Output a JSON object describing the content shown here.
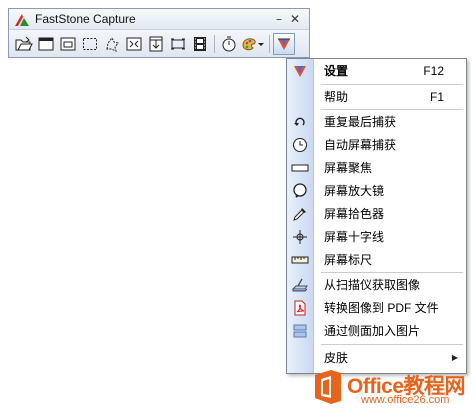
{
  "window": {
    "title": "FastStone Capture",
    "minimize_glyph": "–",
    "close_glyph": "✕"
  },
  "toolbar": {
    "icons": [
      "open-folder-icon",
      "capture-window-icon",
      "capture-object-icon",
      "capture-rectangle-icon",
      "capture-freehand-icon",
      "capture-fullscreen-icon",
      "capture-scrolling-icon",
      "capture-fixed-region-icon",
      "screen-recorder-icon",
      "delay-timer-icon",
      "output-destination-icon",
      "main-menu-icon"
    ]
  },
  "menu": {
    "items": [
      {
        "label": "设置",
        "shortcut": "F12",
        "icon": "settings-icon"
      },
      {
        "label": "帮助",
        "shortcut": "F1"
      },
      {
        "label": "重复最后捕获",
        "icon": "repeat-capture-icon"
      },
      {
        "label": "自动屏幕捕获",
        "icon": "clock-icon"
      },
      {
        "label": "屏幕聚焦",
        "icon": "spotlight-icon"
      },
      {
        "label": "屏幕放大镜",
        "icon": "magnifier-icon"
      },
      {
        "label": "屏幕拾色器",
        "icon": "eyedropper-icon"
      },
      {
        "label": "屏幕十字线",
        "icon": "crosshair-icon"
      },
      {
        "label": "屏幕标尺",
        "icon": "ruler-icon"
      },
      {
        "label": "从扫描仪获取图像",
        "icon": "scanner-icon"
      },
      {
        "label": "转换图像到 PDF 文件",
        "icon": "pdf-icon"
      },
      {
        "label": "通过侧面加入图片",
        "icon": "join-images-icon"
      },
      {
        "label": "皮肤",
        "submenu_glyph": "▶"
      }
    ]
  },
  "watermark": {
    "brand": "Office教程网",
    "url": "www.office26.com"
  },
  "colors": {
    "menu_gutter": "#c9d8f2",
    "watermark_orange": "#e8631c",
    "window_border": "#8a9bb5"
  }
}
